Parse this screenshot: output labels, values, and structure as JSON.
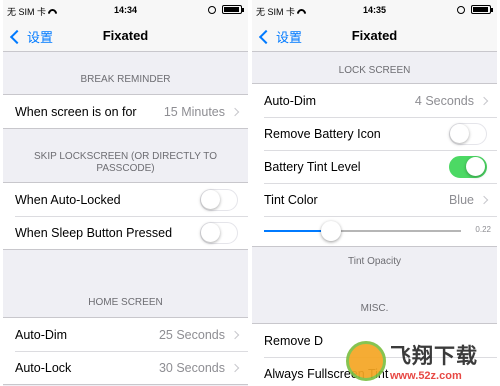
{
  "left": {
    "status": {
      "carrier": "无 SIM 卡",
      "time": "14:34"
    },
    "nav": {
      "back": "设置",
      "title": "Fixated"
    },
    "break_reminder": {
      "header": "BREAK REMINDER",
      "label": "When screen is on for",
      "value": "15 Minutes"
    },
    "skip_lockscreen": {
      "header": "SKIP LOCKSCREEN (OR DIRECTLY TO PASSCODE)",
      "items": [
        {
          "label": "When Auto-Locked",
          "on": false
        },
        {
          "label": "When Sleep Button Pressed",
          "on": false
        }
      ]
    },
    "home_screen": {
      "header": "HOME SCREEN",
      "items": [
        {
          "label": "Auto-Dim",
          "value": "25 Seconds"
        },
        {
          "label": "Auto-Lock",
          "value": "30 Seconds"
        }
      ]
    }
  },
  "right": {
    "status": {
      "carrier": "无 SIM 卡",
      "time": "14:35"
    },
    "nav": {
      "back": "设置",
      "title": "Fixated"
    },
    "lock_screen": {
      "header": "LOCK SCREEN",
      "auto_dim": {
        "label": "Auto-Dim",
        "value": "4 Seconds"
      },
      "remove_battery": {
        "label": "Remove Battery Icon",
        "on": false
      },
      "battery_tint": {
        "label": "Battery Tint Level",
        "on": true
      },
      "tint_color": {
        "label": "Tint Color",
        "value": "Blue"
      },
      "slider": {
        "value_text": "0.22",
        "fraction": 0.34
      },
      "footer": "Tint Opacity"
    },
    "misc": {
      "header": "MISC.",
      "items": [
        {
          "label": "Remove D"
        },
        {
          "label": "Always Fullscreen Tint"
        }
      ]
    }
  },
  "watermark": {
    "title": "飞翔下载",
    "sub": "www.52z.com"
  },
  "colors": {
    "accent": "#007aff",
    "toggle_on": "#4cd964",
    "background": "#efeff4"
  }
}
